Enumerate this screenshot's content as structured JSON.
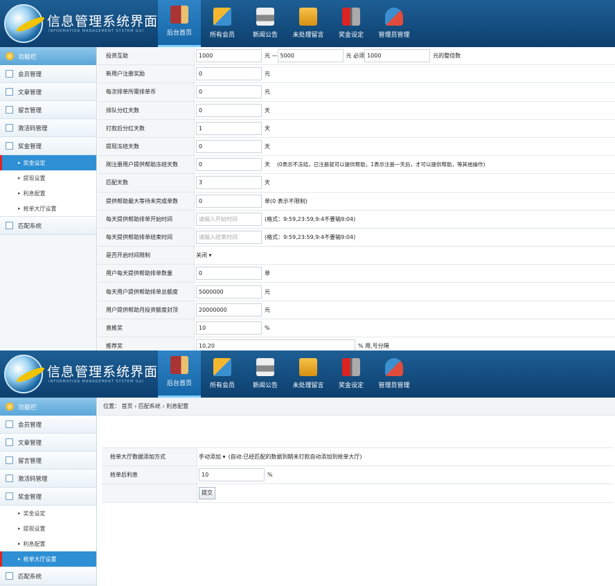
{
  "header": {
    "title": "信息管理系统界面",
    "subtitle": "INFORMATION MANAGEMENT SYSTEM GUI",
    "nav": [
      {
        "label": "后台首页",
        "icon": "book-icon"
      },
      {
        "label": "所有会员",
        "icon": "ruler-icon"
      },
      {
        "label": "新闻公告",
        "icon": "printer-icon"
      },
      {
        "label": "未处理留言",
        "icon": "folder-icon"
      },
      {
        "label": "奖金设定",
        "icon": "tools-icon"
      },
      {
        "label": "管理员管理",
        "icon": "admin-icon"
      }
    ]
  },
  "sidebar": {
    "head": "功能栏",
    "items": [
      "会员管理",
      "文章管理",
      "留言管理",
      "激活码管理",
      "奖金管理"
    ],
    "subitems": [
      "奖金设定",
      "提现设置",
      "利息配置",
      "抢单大厅设置"
    ],
    "last": "匹配系统"
  },
  "settings": {
    "r0": {
      "label": "投资互助",
      "v1": "1000",
      "mid": "元 —",
      "v2": "5000",
      "mid2": "元 必须",
      "v3": "1000",
      "end": "元的整倍数"
    },
    "r1": {
      "label": "新用户注册奖励",
      "value": "0",
      "unit": "元"
    },
    "r2": {
      "label": "每次排单所需排单币",
      "value": "0",
      "unit": "元"
    },
    "r3": {
      "label": "排队分红天数",
      "value": "0",
      "unit": "天"
    },
    "r4": {
      "label": "打款后分红天数",
      "value": "1",
      "unit": "天"
    },
    "r5": {
      "label": "提现冻结天数",
      "value": "0",
      "unit": "天"
    },
    "r6": {
      "label": "刚注册用户提供帮助冻结天数",
      "value": "0",
      "unit": "天",
      "note": "(0表示不冻结，已注册就可以提供帮助，1表示注册一天后，才可以提供帮助，等其他操作)"
    },
    "r7": {
      "label": "匹配天数",
      "value": "3",
      "unit": "天"
    },
    "r8": {
      "label": "提供帮助最大等待未完成单数",
      "value": "0",
      "unit": "单(0 表示不限制)"
    },
    "r9": {
      "label": "每天提供帮助排单开始时间",
      "placeholder": "请输入开始时间",
      "note": "(格式：9:59,23:59,9:4不要输9:04)"
    },
    "r10": {
      "label": "每天提供帮助排单结束时间",
      "placeholder": "请输入结束时间",
      "note": "(格式：9:59,23:59,9:4不要输9:04)"
    },
    "r11": {
      "label": "是否开启时间限制",
      "value": "关闭 ▾"
    },
    "r12": {
      "label": "用户每天提供帮助排单数量",
      "value": "0",
      "unit": "单"
    },
    "r13": {
      "label": "每天用户提供帮助排单总额度",
      "value": "5000000",
      "unit": "元"
    },
    "r14": {
      "label": "用户提供帮助月投资额度封顶",
      "value": "20000000",
      "unit": "元"
    },
    "r15": {
      "label": "直推奖",
      "value": "10",
      "unit": "%"
    },
    "r16": {
      "label": "推荐奖",
      "value": "10,20",
      "unit": "% 用,号分隔"
    }
  },
  "page2": {
    "breadcrumb": "位置：  首页  ›  匹配系统  ›  利息配置",
    "r1": {
      "label": "抢单大厅数据添加方式",
      "value": "手动添加 ▾",
      "note": "(自动:已经匹配的数据到期未打款自动添加到抢单大厅)"
    },
    "r2": {
      "label": "抢单后利息",
      "value": "10",
      "unit": "%"
    },
    "submit": "提交"
  }
}
